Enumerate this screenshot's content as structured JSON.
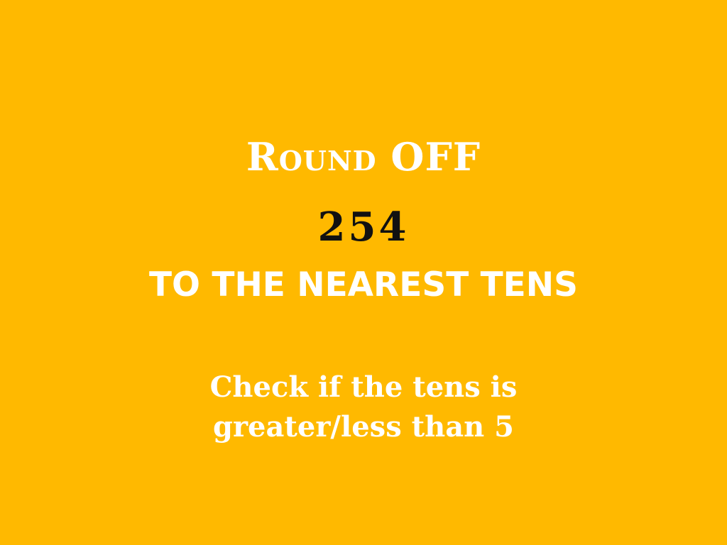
{
  "slide": {
    "title": "Round OFF",
    "number": "254",
    "subtitle": "TO THE NEAREST TENS",
    "hint_line1": "Check if the tens is",
    "hint_line2": "greater/less than 5"
  },
  "colors": {
    "background": "#FFB900",
    "text_light": "#FFFFFF",
    "text_dark": "#111111"
  }
}
